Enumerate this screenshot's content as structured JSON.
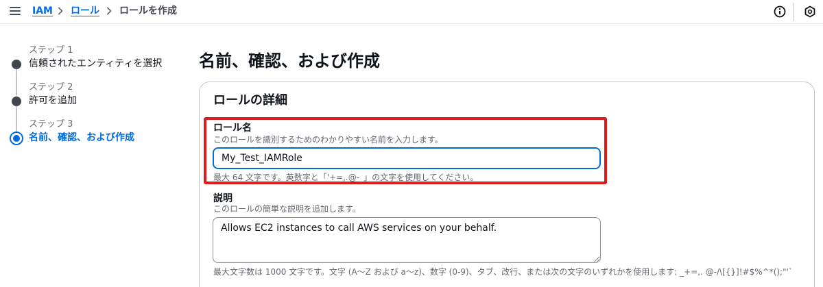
{
  "breadcrumb": {
    "items": [
      "IAM",
      "ロール"
    ],
    "current": "ロールを作成"
  },
  "steps": [
    {
      "number": "ステップ 1",
      "title": "信頼されたエンティティを選択",
      "state": "completed"
    },
    {
      "number": "ステップ 2",
      "title": "許可を追加",
      "state": "completed"
    },
    {
      "number": "ステップ 3",
      "title": "名前、確認、および作成",
      "state": "active"
    }
  ],
  "page": {
    "title": "名前、確認、および作成"
  },
  "role_details": {
    "title": "ロールの詳細",
    "role_name": {
      "label": "ロール名",
      "description": "このロールを識別するためのわかりやすい名前を入力します。",
      "value": "My_Test_IAMRole",
      "constraint": "最大 64 文字です。英数字と「'+=,.@-_」の文字を使用してください。"
    },
    "description": {
      "label": "説明",
      "description": "このロールの簡単な説明を追加します。",
      "value": "Allows EC2 instances to call AWS services on your behalf.",
      "constraint": "最大文字数は 1000 文字です。文字 (A～Z および a～z)、数字 (0-9)、タブ、改行、または次の文字のいずれかを使用します: _+=,. @-/\\[{}]!#$%^*();\"'`"
    }
  },
  "icons": {
    "menu": "hamburger-menu-icon",
    "info": "info-icon",
    "feedback": "feedback-icon"
  },
  "colors": {
    "accent": "#006ce0",
    "highlight": "#e0191f",
    "text": "#0f141a",
    "muted": "#656871"
  }
}
